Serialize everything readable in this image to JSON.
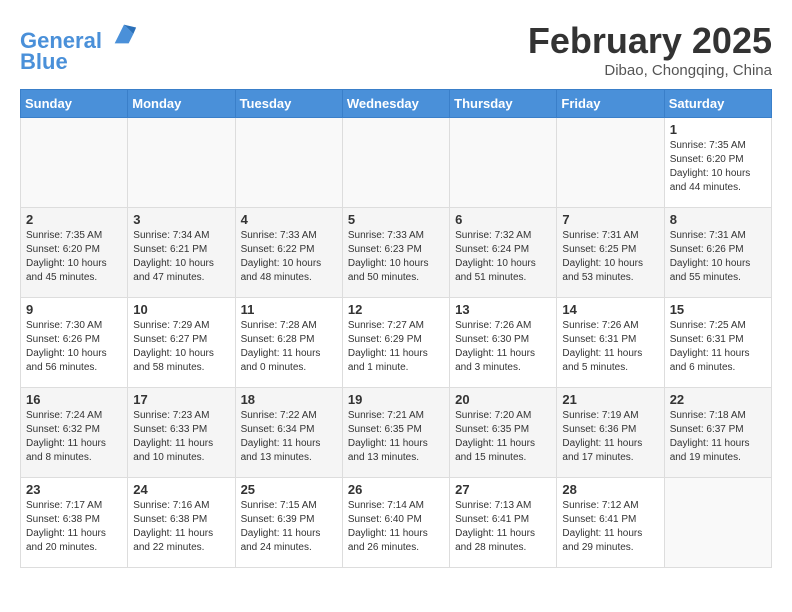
{
  "header": {
    "logo_line1": "General",
    "logo_line2": "Blue",
    "month": "February 2025",
    "location": "Dibao, Chongqing, China"
  },
  "weekdays": [
    "Sunday",
    "Monday",
    "Tuesday",
    "Wednesday",
    "Thursday",
    "Friday",
    "Saturday"
  ],
  "weeks": [
    [
      {
        "day": "",
        "info": ""
      },
      {
        "day": "",
        "info": ""
      },
      {
        "day": "",
        "info": ""
      },
      {
        "day": "",
        "info": ""
      },
      {
        "day": "",
        "info": ""
      },
      {
        "day": "",
        "info": ""
      },
      {
        "day": "1",
        "info": "Sunrise: 7:35 AM\nSunset: 6:20 PM\nDaylight: 10 hours and 44 minutes."
      }
    ],
    [
      {
        "day": "2",
        "info": "Sunrise: 7:35 AM\nSunset: 6:20 PM\nDaylight: 10 hours and 45 minutes."
      },
      {
        "day": "3",
        "info": "Sunrise: 7:34 AM\nSunset: 6:21 PM\nDaylight: 10 hours and 47 minutes."
      },
      {
        "day": "4",
        "info": "Sunrise: 7:33 AM\nSunset: 6:22 PM\nDaylight: 10 hours and 48 minutes."
      },
      {
        "day": "5",
        "info": "Sunrise: 7:33 AM\nSunset: 6:23 PM\nDaylight: 10 hours and 50 minutes."
      },
      {
        "day": "6",
        "info": "Sunrise: 7:32 AM\nSunset: 6:24 PM\nDaylight: 10 hours and 51 minutes."
      },
      {
        "day": "7",
        "info": "Sunrise: 7:31 AM\nSunset: 6:25 PM\nDaylight: 10 hours and 53 minutes."
      },
      {
        "day": "8",
        "info": "Sunrise: 7:31 AM\nSunset: 6:26 PM\nDaylight: 10 hours and 55 minutes."
      }
    ],
    [
      {
        "day": "9",
        "info": "Sunrise: 7:30 AM\nSunset: 6:26 PM\nDaylight: 10 hours and 56 minutes."
      },
      {
        "day": "10",
        "info": "Sunrise: 7:29 AM\nSunset: 6:27 PM\nDaylight: 10 hours and 58 minutes."
      },
      {
        "day": "11",
        "info": "Sunrise: 7:28 AM\nSunset: 6:28 PM\nDaylight: 11 hours and 0 minutes."
      },
      {
        "day": "12",
        "info": "Sunrise: 7:27 AM\nSunset: 6:29 PM\nDaylight: 11 hours and 1 minute."
      },
      {
        "day": "13",
        "info": "Sunrise: 7:26 AM\nSunset: 6:30 PM\nDaylight: 11 hours and 3 minutes."
      },
      {
        "day": "14",
        "info": "Sunrise: 7:26 AM\nSunset: 6:31 PM\nDaylight: 11 hours and 5 minutes."
      },
      {
        "day": "15",
        "info": "Sunrise: 7:25 AM\nSunset: 6:31 PM\nDaylight: 11 hours and 6 minutes."
      }
    ],
    [
      {
        "day": "16",
        "info": "Sunrise: 7:24 AM\nSunset: 6:32 PM\nDaylight: 11 hours and 8 minutes."
      },
      {
        "day": "17",
        "info": "Sunrise: 7:23 AM\nSunset: 6:33 PM\nDaylight: 11 hours and 10 minutes."
      },
      {
        "day": "18",
        "info": "Sunrise: 7:22 AM\nSunset: 6:34 PM\nDaylight: 11 hours and 13 minutes."
      },
      {
        "day": "19",
        "info": "Sunrise: 7:21 AM\nSunset: 6:35 PM\nDaylight: 11 hours and 13 minutes."
      },
      {
        "day": "20",
        "info": "Sunrise: 7:20 AM\nSunset: 6:35 PM\nDaylight: 11 hours and 15 minutes."
      },
      {
        "day": "21",
        "info": "Sunrise: 7:19 AM\nSunset: 6:36 PM\nDaylight: 11 hours and 17 minutes."
      },
      {
        "day": "22",
        "info": "Sunrise: 7:18 AM\nSunset: 6:37 PM\nDaylight: 11 hours and 19 minutes."
      }
    ],
    [
      {
        "day": "23",
        "info": "Sunrise: 7:17 AM\nSunset: 6:38 PM\nDaylight: 11 hours and 20 minutes."
      },
      {
        "day": "24",
        "info": "Sunrise: 7:16 AM\nSunset: 6:38 PM\nDaylight: 11 hours and 22 minutes."
      },
      {
        "day": "25",
        "info": "Sunrise: 7:15 AM\nSunset: 6:39 PM\nDaylight: 11 hours and 24 minutes."
      },
      {
        "day": "26",
        "info": "Sunrise: 7:14 AM\nSunset: 6:40 PM\nDaylight: 11 hours and 26 minutes."
      },
      {
        "day": "27",
        "info": "Sunrise: 7:13 AM\nSunset: 6:41 PM\nDaylight: 11 hours and 28 minutes."
      },
      {
        "day": "28",
        "info": "Sunrise: 7:12 AM\nSunset: 6:41 PM\nDaylight: 11 hours and 29 minutes."
      },
      {
        "day": "",
        "info": ""
      }
    ]
  ]
}
